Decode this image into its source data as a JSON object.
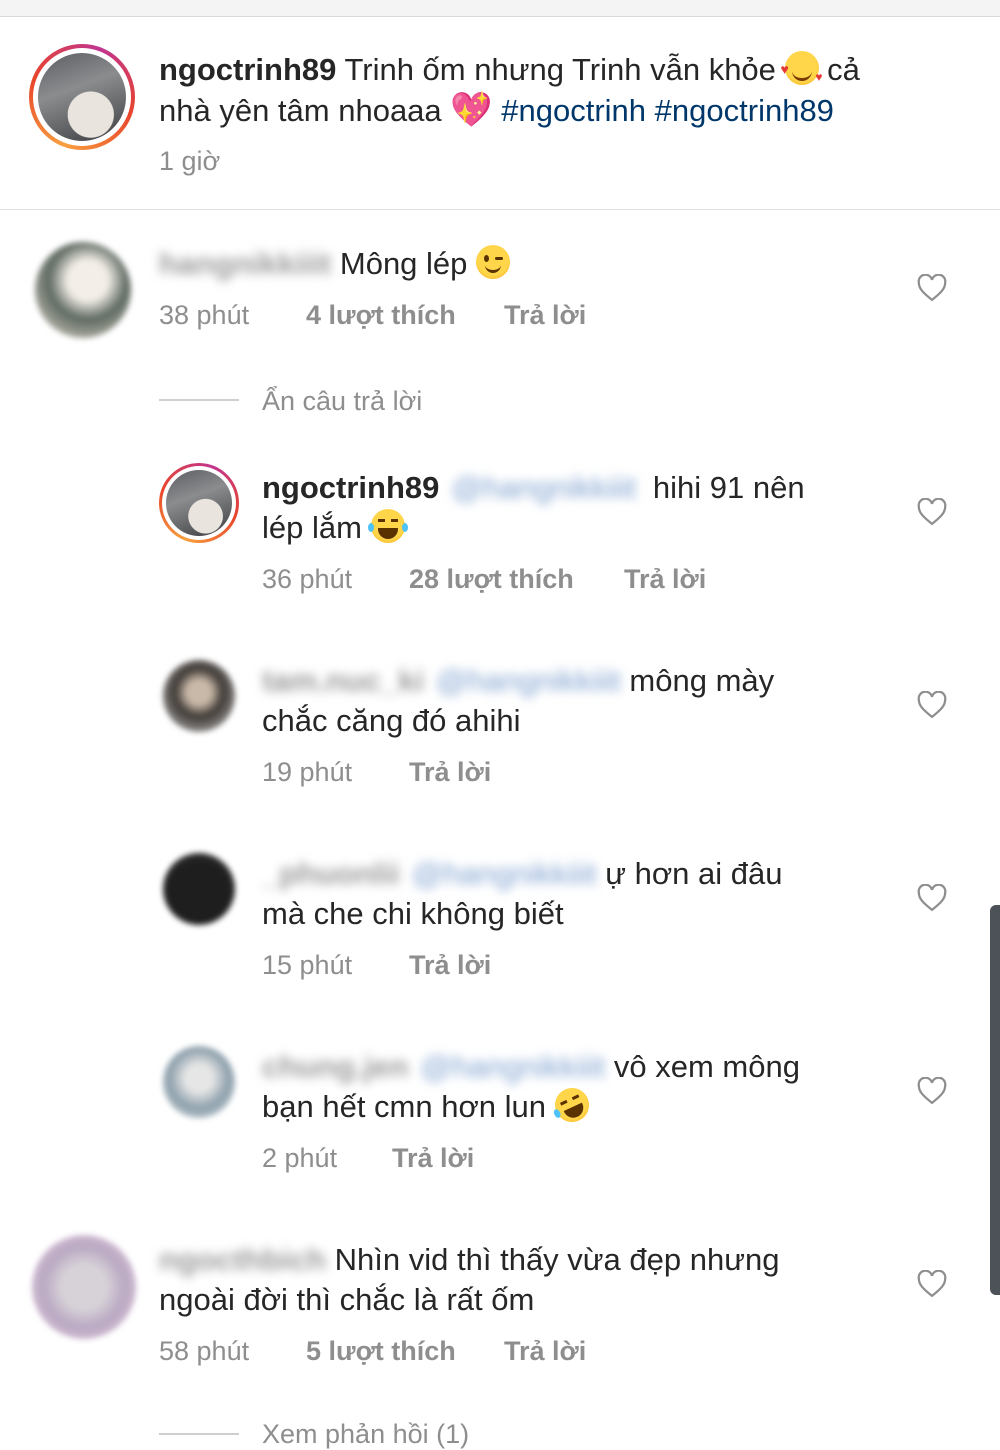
{
  "post": {
    "username": "ngoctrinh89",
    "caption_part1": "Trinh ốm nhưng Trinh vẫn khỏe",
    "caption_part2": "cả",
    "caption_part3": "nhà yên tâm nhoaaa",
    "hashtag1": "#ngoctrinh",
    "hashtag2": "#ngoctrinh89",
    "time": "1 giờ"
  },
  "comments": [
    {
      "username": "hangnikkiiit",
      "text": "Mông lép",
      "time": "38 phút",
      "likes": "4 lượt thích",
      "reply_label": "Trả lời",
      "toggle_replies": "Ẩn câu trả lời",
      "replies": [
        {
          "username": "ngoctrinh89",
          "mention": "@hangnikkiiit",
          "text_line1": "hihi 91 nên",
          "text_line2": "lép lắm",
          "time": "36 phút",
          "likes": "28 lượt thích",
          "reply_label": "Trả lời"
        },
        {
          "username": "tam.nuc_ki",
          "mention": "@hangnikkiiit",
          "text_line1": "mông mày",
          "text_line2": "chắc căng đó ahihi",
          "time": "19 phút",
          "reply_label": "Trả lời"
        },
        {
          "username": "_phuonlii",
          "mention": "@hangnikkiiit",
          "text_line1": "ự hơn ai đâu",
          "text_line2": "mà che chi không biết",
          "time": "15 phút",
          "reply_label": "Trả lời"
        },
        {
          "username": "chung.jen",
          "mention": "@hangnikkiiit",
          "text_line1": "vô xem mông",
          "text_line2": "bạn hết cmn hơn lun",
          "time": "2 phút",
          "reply_label": "Trả lời"
        }
      ]
    },
    {
      "username": "ngocthbich",
      "text_line1": "Nhìn vid thì thấy vừa đẹp nhưng",
      "text_line2": "ngoài đời thì chắc là rất ốm",
      "time": "58 phút",
      "likes": "5 lượt thích",
      "reply_label": "Trả lời",
      "toggle_replies": "Xem phản hồi (1)"
    }
  ],
  "icons": {
    "like": "heart-outline-icon",
    "emoji_love": "smiling-face-with-hearts-emoji",
    "emoji_heart": "sparkling-heart-emoji",
    "emoji_wink": "winking-face-emoji",
    "emoji_laugh": "face-with-tears-of-joy-emoji",
    "emoji_rofl": "rolling-on-floor-laughing-emoji"
  },
  "colors": {
    "text": "#262626",
    "meta": "#8e8e8e",
    "hashtag": "#00376b"
  }
}
